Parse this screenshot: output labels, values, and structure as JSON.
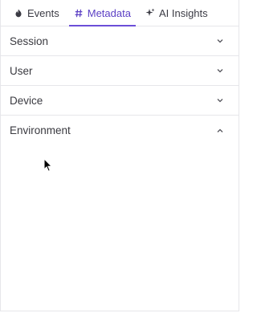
{
  "tabs": [
    {
      "label": "Events",
      "icon": "flame-icon"
    },
    {
      "label": "Metadata",
      "icon": "hash-icon"
    },
    {
      "label": "AI Insights",
      "icon": "sparkles-icon"
    }
  ],
  "active_tab": "Metadata",
  "sections": [
    {
      "label": "Session",
      "expanded": false
    },
    {
      "label": "User",
      "expanded": false
    },
    {
      "label": "Device",
      "expanded": false
    },
    {
      "label": "Environment",
      "expanded": true
    }
  ],
  "colors": {
    "accent": "#6b4fd8",
    "text": "#3a3a40",
    "border": "#e6e6ea"
  }
}
